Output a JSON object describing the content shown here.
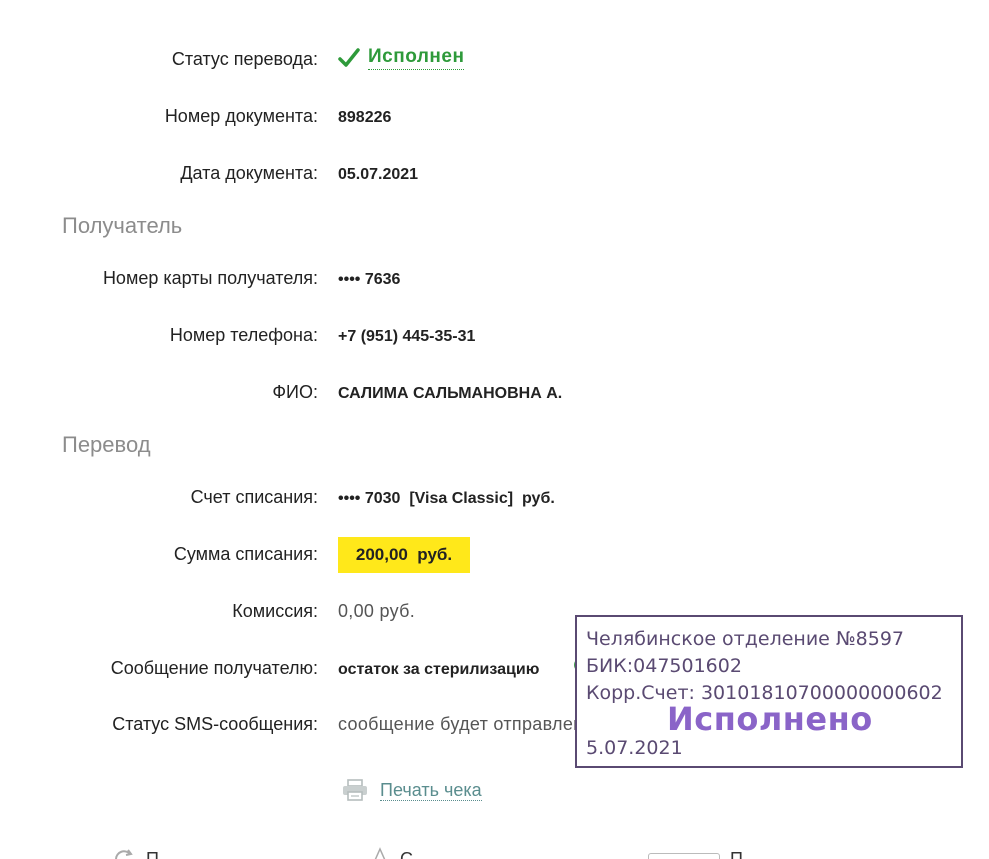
{
  "transfer_status": {
    "label": "Статус перевода:",
    "value": "Исполнен"
  },
  "document_number": {
    "label": "Номер документа:",
    "value": "898226"
  },
  "document_date": {
    "label": "Дата документа:",
    "value": "05.07.2021"
  },
  "recipient": {
    "section_title": "Получатель",
    "card": {
      "label": "Номер карты получателя:",
      "value": "•••• 7636"
    },
    "phone": {
      "label": "Номер телефона:",
      "value": "+7 (951) 445-35-31"
    },
    "name": {
      "label": "ФИО:",
      "value": "САЛИМА САЛЬМАНОВНА А."
    }
  },
  "transfer": {
    "section_title": "Перевод",
    "account": {
      "label": "Счет списания:",
      "value": "•••• 7030  [Visa Classic]  руб."
    },
    "amount": {
      "label": "Сумма списания:",
      "value": "200,00  руб."
    },
    "fee": {
      "label": "Комиссия:",
      "value": "0,00 руб."
    },
    "message": {
      "label": "Сообщение получателю:",
      "value": "остаток за стерилизацию"
    },
    "sms_status": {
      "label": "Статус SMS-сообщения:",
      "value": "сообщение будет отправлено"
    }
  },
  "stamp": {
    "branch": "Челябинское отделение №8597",
    "bik": "БИК:047501602",
    "corr_account": "Корр.Счет: 30101810700000000602",
    "status": "Исполнено",
    "date": "5.07.2021"
  },
  "print_receipt": "Печать чека",
  "colors": {
    "success": "#2e9a3a",
    "highlight": "#ffe81a",
    "stamp": "#5a4a72",
    "link": "#5a8d8e"
  }
}
